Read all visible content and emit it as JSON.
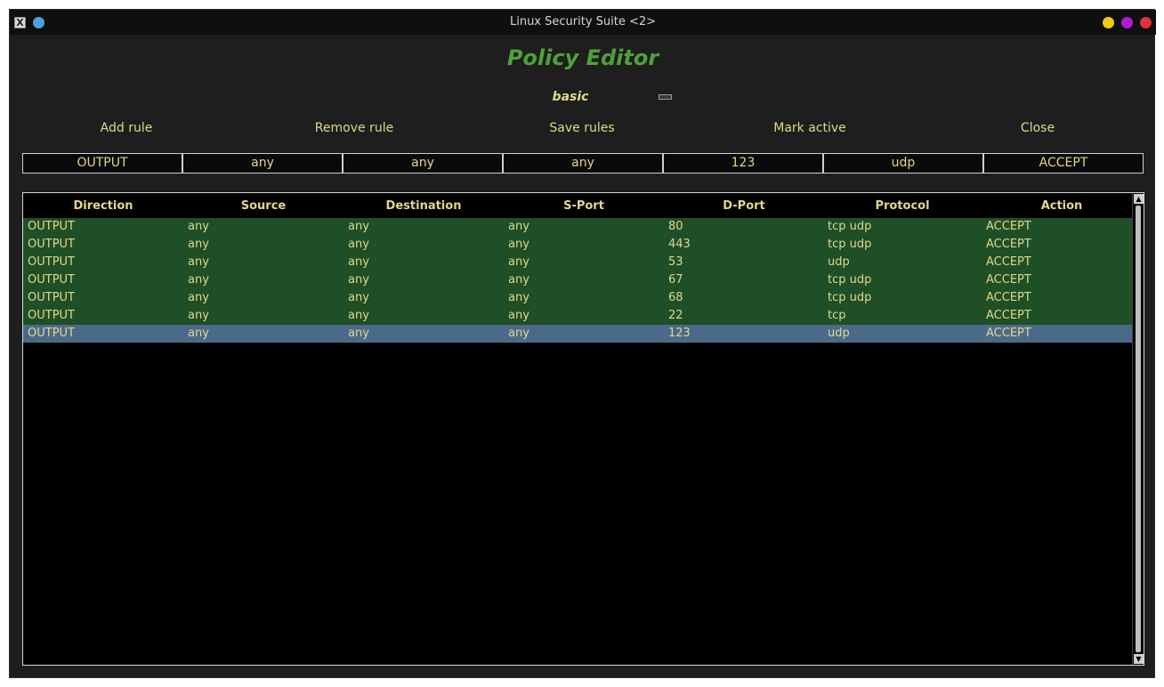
{
  "window": {
    "title": "Linux Security Suite <2>",
    "app_icon_glyph": "X",
    "pin_color": "#4aa3df",
    "button_colors": {
      "minimize": "#f2c811",
      "maximize": "#b517d4",
      "close": "#e0303a"
    }
  },
  "heading": "Policy Editor",
  "profile": {
    "name": "basic"
  },
  "toolbar": {
    "add_rule": "Add rule",
    "remove_rule": "Remove rule",
    "save_rules": "Save rules",
    "mark_active": "Mark active",
    "close": "Close"
  },
  "editor": {
    "direction": "OUTPUT",
    "source": "any",
    "destination": "any",
    "sport": "any",
    "dport": "123",
    "protocol": "udp",
    "action": "ACCEPT"
  },
  "table": {
    "columns": [
      "Direction",
      "Source",
      "Destination",
      "S-Port",
      "D-Port",
      "Protocol",
      "Action"
    ],
    "rows": [
      [
        "OUTPUT",
        "any",
        "any",
        "any",
        "80",
        "tcp udp",
        "ACCEPT"
      ],
      [
        "OUTPUT",
        "any",
        "any",
        "any",
        "443",
        "tcp udp",
        "ACCEPT"
      ],
      [
        "OUTPUT",
        "any",
        "any",
        "any",
        "53",
        "udp",
        "ACCEPT"
      ],
      [
        "OUTPUT",
        "any",
        "any",
        "any",
        "67",
        "tcp udp",
        "ACCEPT"
      ],
      [
        "OUTPUT",
        "any",
        "any",
        "any",
        "68",
        "tcp udp",
        "ACCEPT"
      ],
      [
        "OUTPUT",
        "any",
        "any",
        "any",
        "22",
        "tcp",
        "ACCEPT"
      ],
      [
        "OUTPUT",
        "any",
        "any",
        "any",
        "123",
        "udp",
        "ACCEPT"
      ]
    ],
    "selected_row": 6
  },
  "colors": {
    "row_active": "#1f4f27",
    "row_selected": "#4b6a8a",
    "text": "#e2d78a",
    "heading": "#4da13a"
  },
  "icons": {
    "scroll_up": "scroll-up-arrow-icon",
    "scroll_down": "scroll-down-arrow-icon"
  }
}
